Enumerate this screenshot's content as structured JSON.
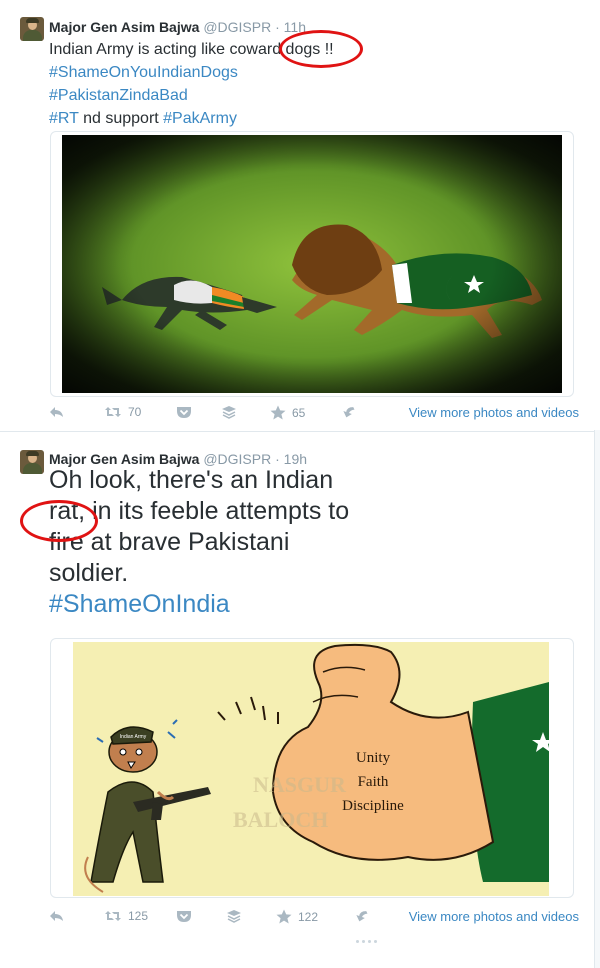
{
  "colors": {
    "link": "#3b88c3",
    "meta": "#8899a6",
    "text": "#292f33",
    "annotation": "#e01313"
  },
  "tweets": [
    {
      "author_name": "Major Gen Asim Bajwa",
      "handle": "@DGISPR",
      "dot": "·",
      "time": "11h",
      "lines": [
        {
          "parts": [
            {
              "text": "Indian Army is acting like coward dogs !!",
              "kind": "plain"
            }
          ]
        },
        {
          "parts": [
            {
              "text": "#ShameOnYouIndianDogs",
              "kind": "hashtag"
            }
          ]
        },
        {
          "parts": [
            {
              "text": "#PakistanZindaBad",
              "kind": "hashtag"
            }
          ]
        },
        {
          "parts": [
            {
              "text": "#RT",
              "kind": "hashtag"
            },
            {
              "text": " nd support ",
              "kind": "plain"
            },
            {
              "text": "#PakArmy",
              "kind": "hashtag"
            }
          ]
        }
      ],
      "retweet_count": "70",
      "like_count": "65",
      "more_link": "View more photos and videos"
    },
    {
      "author_name": "Major Gen Asim Bajwa",
      "handle": "@DGISPR",
      "dot": "·",
      "time": "19h",
      "lines": [
        {
          "parts": [
            {
              "text": "Oh look, there's an Indian",
              "kind": "plain"
            }
          ]
        },
        {
          "parts": [
            {
              "text": "rat, in its feeble attempts to",
              "kind": "plain"
            }
          ]
        },
        {
          "parts": [
            {
              "text": "fire at brave Pakistani",
              "kind": "plain"
            }
          ]
        },
        {
          "parts": [
            {
              "text": "soldier.",
              "kind": "plain"
            }
          ]
        },
        {
          "parts": [
            {
              "text": "#ShameOnIndia",
              "kind": "hashtag"
            }
          ]
        }
      ],
      "retweet_count": "125",
      "like_count": "122",
      "more_link": "View more photos and videos"
    }
  ],
  "cartoon": {
    "arm_text": [
      "Unity",
      "Faith",
      "Discipline"
    ],
    "cap_text": "Indian Army",
    "watermark": [
      "NASGUR",
      "BALOCH"
    ]
  },
  "icons": [
    "reply-icon",
    "retweet-icon",
    "pocket-icon",
    "buffer-icon",
    "like-star-icon",
    "share-icon",
    "drag-dots-icon"
  ]
}
